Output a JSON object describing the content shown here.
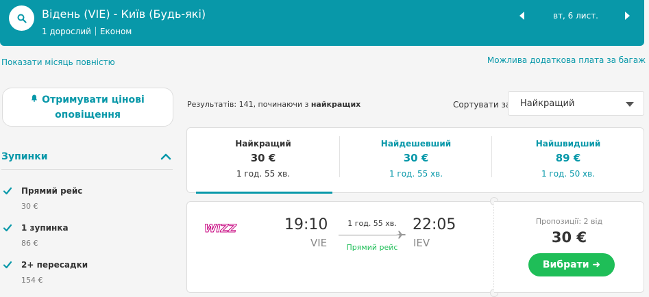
{
  "header": {
    "route": "Відень (VIE) - Київ (Будь-які)",
    "passengers": "1 дорослий",
    "cabin": "Економ",
    "date": "вт, 6 лист."
  },
  "links": {
    "full_month": "Показати місяць повністю",
    "baggage": "Можлива додаткова плата за багаж"
  },
  "sidebar": {
    "alert_line1": "Отримувати цінові",
    "alert_line2": "оповіщення",
    "stops_title": "Зупинки",
    "stops": [
      {
        "label": "Прямий рейс",
        "price": "30 €",
        "checked": true
      },
      {
        "label": "1 зупинка",
        "price": "86 €",
        "checked": true
      },
      {
        "label": "2+ пересадки",
        "price": "154 €",
        "checked": true
      }
    ]
  },
  "results": {
    "count_prefix": "Результатів: 141, починаючи з ",
    "count_bold": "найкращих",
    "sort_label": "Сортувати за",
    "sort_value": "Найкращий"
  },
  "tabs": [
    {
      "label": "Найкращий",
      "price": "30 €",
      "duration": "1 год. 55 хв.",
      "active": true
    },
    {
      "label": "Найдешевший",
      "price": "30 €",
      "duration": "1 год. 55 хв.",
      "active": false
    },
    {
      "label": "Найшвидший",
      "price": "89 €",
      "duration": "1 год. 50 хв.",
      "active": false
    }
  ],
  "flight": {
    "airline": "WIZZ",
    "dep_time": "19:10",
    "dep_code": "VIE",
    "arr_time": "22:05",
    "arr_code": "IEV",
    "duration": "1 год. 55 хв.",
    "stops": "Прямий рейс",
    "offers": "Пропозиції: 2 від",
    "price": "30 €",
    "select_label": "Вибрати ➜"
  },
  "colors": {
    "accent": "#0898a9",
    "green": "#1fbe58",
    "wizz": "#c6007e"
  }
}
